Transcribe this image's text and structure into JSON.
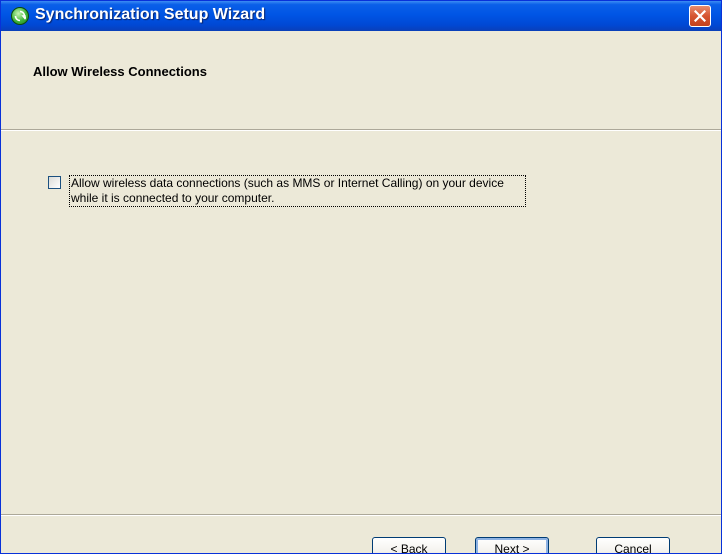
{
  "window": {
    "title": "Synchronization Setup Wizard",
    "close_icon": "close-x-icon",
    "app_icon": "sync-green-icon"
  },
  "header": {
    "title": "Allow Wireless Connections"
  },
  "body": {
    "checkbox": {
      "checked": false,
      "label": "Allow wireless data connections (such as MMS or Internet Calling) on your device while it is connected to your computer."
    }
  },
  "buttons": {
    "back_prefix": "< ",
    "back_hotkey": "B",
    "back_rest": "ack",
    "next_hotkey": "N",
    "next_rest": "ext >",
    "cancel": "Cancel"
  },
  "colors": {
    "title_bar": "#0055E5",
    "close_button": "#D65430",
    "window_bg": "#ECE9D8"
  }
}
